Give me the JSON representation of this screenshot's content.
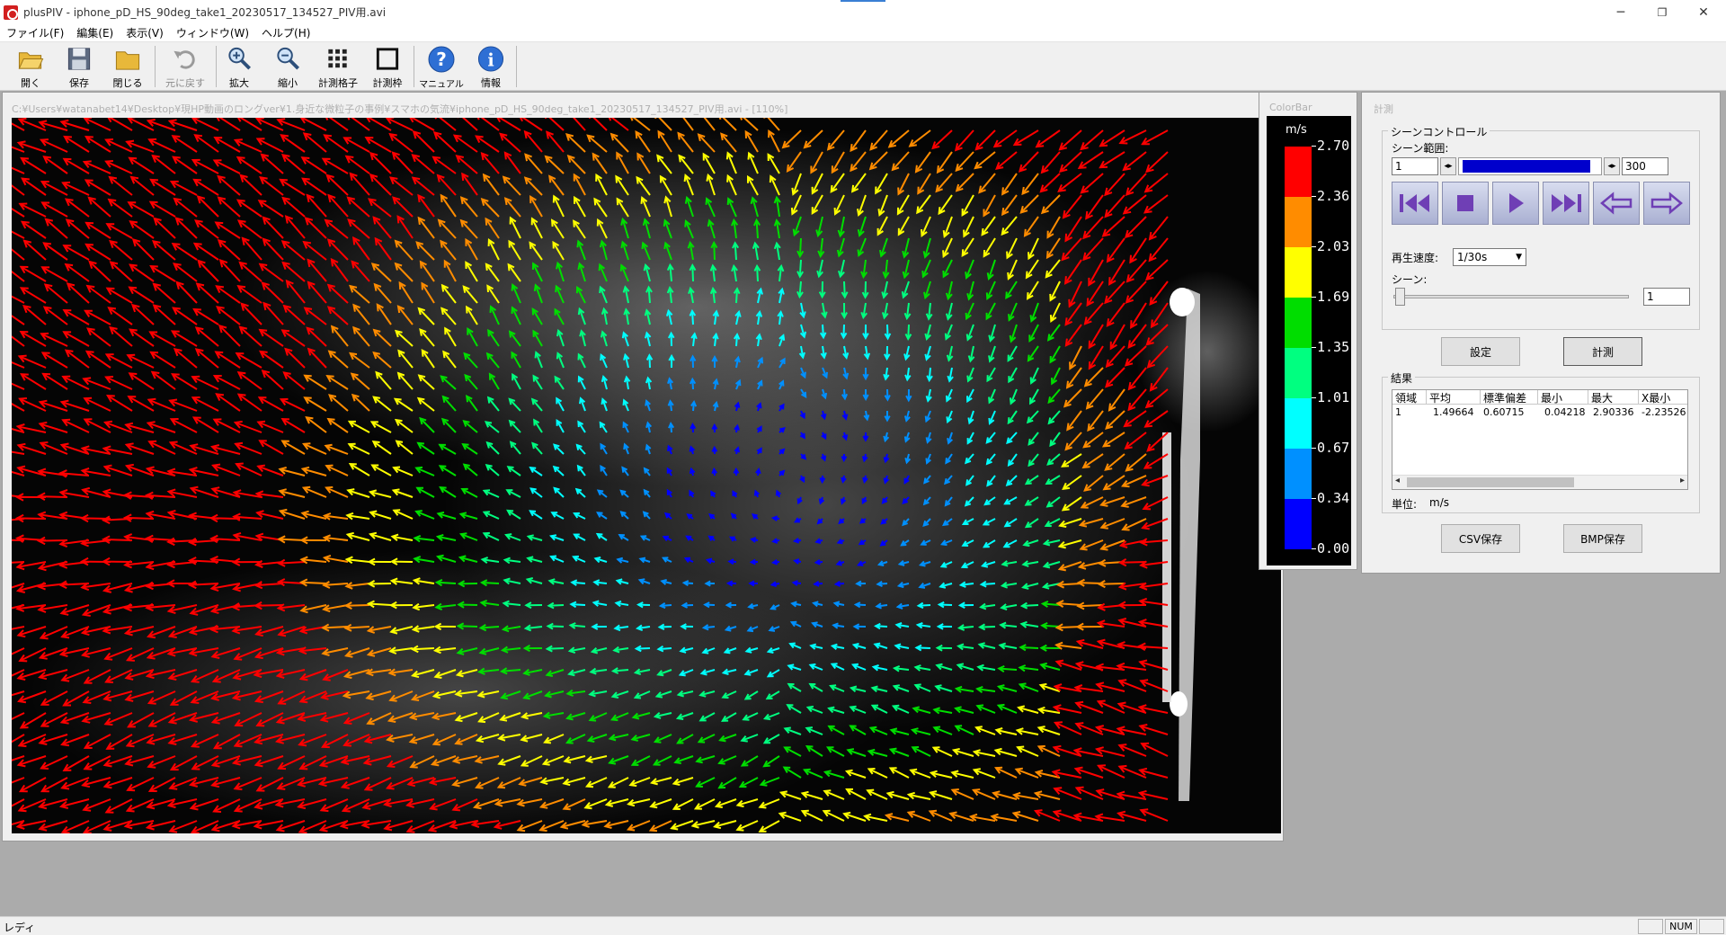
{
  "window": {
    "title": "plusPIV - iphone_pD_HS_90deg_take1_20230517_134527_PIV用.avi",
    "minimize": "─",
    "restore": "❐",
    "close": "✕"
  },
  "menu": [
    "ファイル(F)",
    "編集(E)",
    "表示(V)",
    "ウィンドウ(W)",
    "ヘルプ(H)"
  ],
  "toolbar": {
    "open": "開く",
    "save": "保存",
    "close": "閉じる",
    "undo": "元に戻す",
    "zoom_in": "拡大",
    "zoom_out": "縮小",
    "grid": "計測格子",
    "frame": "計測枠",
    "manual": "マニュアル",
    "info": "情報"
  },
  "image_window": {
    "title": "C:¥Users¥watanabet14¥Desktop¥現HP動画のロングver¥1.身近な微粒子の事例¥スマホの気流¥iphone_pD_HS_90deg_take1_20230517_134527_PIV用.avi - [110%]"
  },
  "colorbar": {
    "title": "ColorBar",
    "unit": "m/s",
    "ticks": [
      "2.70",
      "2.36",
      "2.03",
      "1.69",
      "1.35",
      "1.01",
      "0.67",
      "0.34",
      "0.00"
    ],
    "colors": [
      "#ff0000",
      "#ff8c00",
      "#ffff00",
      "#00dd00",
      "#00ff80",
      "#00ffff",
      "#0090ff",
      "#0000ff"
    ]
  },
  "measure": {
    "title": "計測",
    "scene_control": {
      "group_label": "シーンコントロール",
      "range_label": "シーン範囲:",
      "range_start": "1",
      "range_end": "300",
      "speed_label": "再生速度:",
      "speed_value": "1/30s",
      "scene_label": "シーン:",
      "scene_value": "1"
    },
    "settings_button": "設定",
    "measure_button": "計測",
    "results": {
      "group_label": "結果",
      "columns": [
        "領域",
        "平均",
        "標準偏差",
        "最小",
        "最大",
        "X最小"
      ],
      "rows": [
        [
          "1",
          "1.49664",
          "0.60715",
          "0.04218",
          "2.90336",
          "-2.23526"
        ]
      ],
      "unit_label": "単位:",
      "unit_value": "m/s"
    },
    "csv_button": "CSV保存",
    "bmp_button": "BMP保存"
  },
  "status": {
    "text": "レディ",
    "num": "NUM"
  }
}
